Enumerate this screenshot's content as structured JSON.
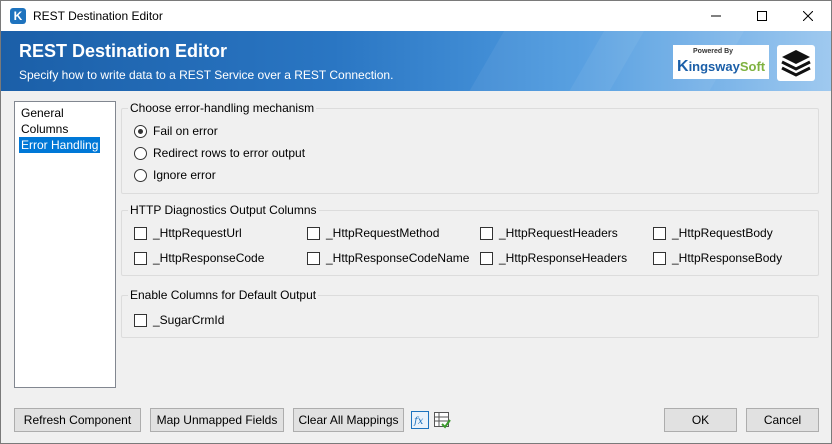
{
  "window": {
    "title": "REST Destination Editor",
    "app_icon_letter": "K"
  },
  "banner": {
    "title": "REST Destination Editor",
    "subtitle": "Specify how to write data to a REST Service over a REST Connection.",
    "brand_powered": "Powered By",
    "brand_k": "K",
    "brand_ingsway": "ingsway",
    "brand_soft": "Soft"
  },
  "nav": {
    "items": [
      {
        "label": "General"
      },
      {
        "label": "Columns"
      },
      {
        "label": "Error Handling"
      }
    ],
    "selected_index": 2
  },
  "error_handling": {
    "title": "Choose error-handling mechanism",
    "options": [
      {
        "label": "Fail on error",
        "checked": true
      },
      {
        "label": "Redirect rows to error output",
        "checked": false
      },
      {
        "label": "Ignore error",
        "checked": false
      }
    ]
  },
  "http_diagnostics": {
    "title": "HTTP Diagnostics Output Columns",
    "columns": [
      {
        "label": "_HttpRequestUrl",
        "checked": false
      },
      {
        "label": "_HttpRequestMethod",
        "checked": false
      },
      {
        "label": "_HttpRequestHeaders",
        "checked": false
      },
      {
        "label": "_HttpRequestBody",
        "checked": false
      },
      {
        "label": "_HttpResponseCode",
        "checked": false
      },
      {
        "label": "_HttpResponseCodeName",
        "checked": false
      },
      {
        "label": "_HttpResponseHeaders",
        "checked": false
      },
      {
        "label": "_HttpResponseBody",
        "checked": false
      }
    ]
  },
  "default_output": {
    "title": "Enable Columns for Default Output",
    "columns": [
      {
        "label": "_SugarCrmId",
        "checked": false
      }
    ]
  },
  "buttons": {
    "refresh": "Refresh Component",
    "map_unmapped": "Map Unmapped Fields",
    "clear_mappings": "Clear All Mappings",
    "ok": "OK",
    "cancel": "Cancel"
  },
  "colors": {
    "selection": "#0078d7",
    "banner_dark": "#1b5fa8",
    "brand_green": "#7fb241"
  }
}
